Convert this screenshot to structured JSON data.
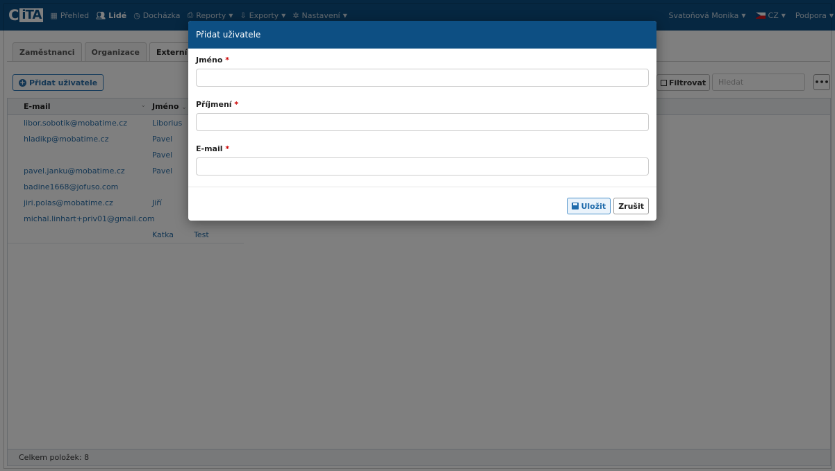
{
  "app": {
    "logo_left": "C",
    "logo_right": "iTA"
  },
  "nav": {
    "items": [
      {
        "icon": "grid-icon",
        "label": "Přehled",
        "caret": false
      },
      {
        "icon": "people-icon",
        "label": "Lidé",
        "caret": false,
        "active": true
      },
      {
        "icon": "clock-icon",
        "label": "Docházka",
        "caret": false
      },
      {
        "icon": "printer-icon",
        "label": "Reporty",
        "caret": true
      },
      {
        "icon": "export-icon",
        "label": "Exporty",
        "caret": true
      },
      {
        "icon": "gear-icon",
        "label": "Nastavení",
        "caret": true
      }
    ],
    "user": "Svatoňová Monika",
    "language": "CZ",
    "support": "Podpora"
  },
  "tabs": [
    "Zaměstnanci",
    "Organizace",
    "Externí uživatelé"
  ],
  "toolbar": {
    "add_label": "Přidat uživatele",
    "filter_label": "Filtrovat",
    "search_placeholder": "Hledat",
    "more_label": "•••"
  },
  "grid": {
    "columns": {
      "email": "E-mail",
      "name": "Jméno"
    },
    "rows": [
      {
        "email": "libor.sobotik@mobatime.cz",
        "name": "Liborius",
        "surname": ""
      },
      {
        "email": "hladikp@mobatime.cz",
        "name": "Pavel",
        "surname": ""
      },
      {
        "email": "",
        "name": "Pavel",
        "surname": ""
      },
      {
        "email": "pavel.janku@mobatime.cz",
        "name": "Pavel",
        "surname": ""
      },
      {
        "email": "badine1668@jofuso.com",
        "name": "",
        "surname": ""
      },
      {
        "email": "jiri.polas@mobatime.cz",
        "name": "Jiří",
        "surname": ""
      },
      {
        "email": "michal.linhart+priv01@gmail.com",
        "name": "",
        "surname": ""
      },
      {
        "email": "",
        "name": "Katka",
        "surname": "Test"
      }
    ],
    "footer": "Celkem položek: 8"
  },
  "modal": {
    "title": "Přidat uživatele",
    "fields": [
      {
        "label": "Jméno",
        "required": "*",
        "value": ""
      },
      {
        "label": "Příjmení",
        "required": "*",
        "value": ""
      },
      {
        "label": "E-mail",
        "required": "*",
        "value": ""
      }
    ],
    "save_label": "Uložit",
    "cancel_label": "Zrušit"
  },
  "colors": {
    "brand": "#0d4f83",
    "link": "#2a6fa8",
    "required": "#cc0000"
  }
}
